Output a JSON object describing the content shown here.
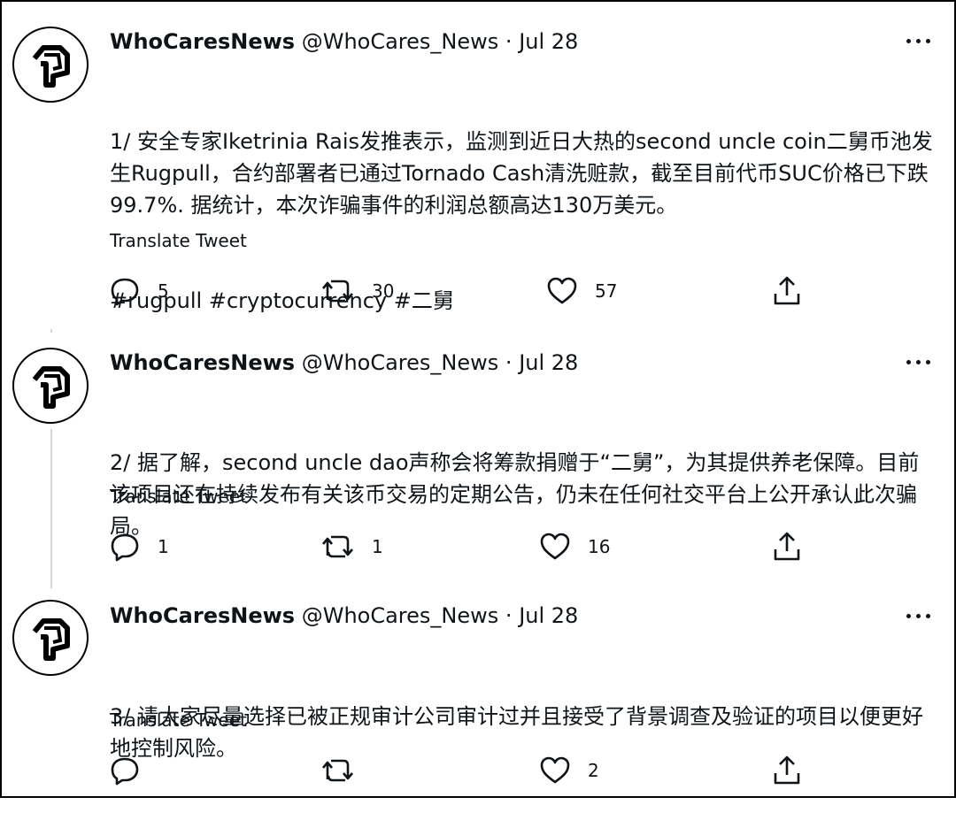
{
  "tweets": [
    {
      "display_name": "WhoCaresNews",
      "handle": "@WhoCares_News",
      "sep": "·",
      "date": "Jul 28",
      "text": "1/ 安全专家Iketrinia Rais发推表示，监测到近日大热的second uncle coin二舅币池发生Rugpull，合约部署者已通过Tornado Cash清洗赃款，截至目前代币SUC价格已下跌99.7%. 据统计，本次诈骗事件的利润总额高达130万美元。",
      "hashtags": "#rugpull #cryptocurrency #二舅",
      "translate": "Translate Tweet",
      "replies": "5",
      "retweets": "30",
      "likes": "57"
    },
    {
      "display_name": "WhoCaresNews",
      "handle": "@WhoCares_News",
      "sep": "·",
      "date": "Jul 28",
      "text": "2/ 据了解，second uncle dao声称会将筹款捐赠于“二舅”，为其提供养老保障。目前该项目还在持续发布有关该币交易的定期公告，仍未在任何社交平台上公开承认此次骗局。",
      "hashtags": "",
      "translate": "Translate Tweet",
      "replies": "1",
      "retweets": "1",
      "likes": "16"
    },
    {
      "display_name": "WhoCaresNews",
      "handle": "@WhoCares_News",
      "sep": "·",
      "date": "Jul 28",
      "text": "3/ 请大家尽量选择已被正规审计公司审计过并且接受了背景调查及验证的项目以便更好地控制风险。",
      "hashtags": "",
      "translate": "Translate Tweet",
      "replies": "",
      "retweets": "",
      "likes": "2"
    }
  ],
  "icons": {
    "avatar": "whocares-logo-icon",
    "more": "more-horizontal-icon",
    "reply": "reply-bubble-icon",
    "retweet": "retweet-icon",
    "like": "heart-icon",
    "share": "share-icon"
  },
  "colors": {
    "text": "#0f1419",
    "thread": "#cfd9de"
  }
}
